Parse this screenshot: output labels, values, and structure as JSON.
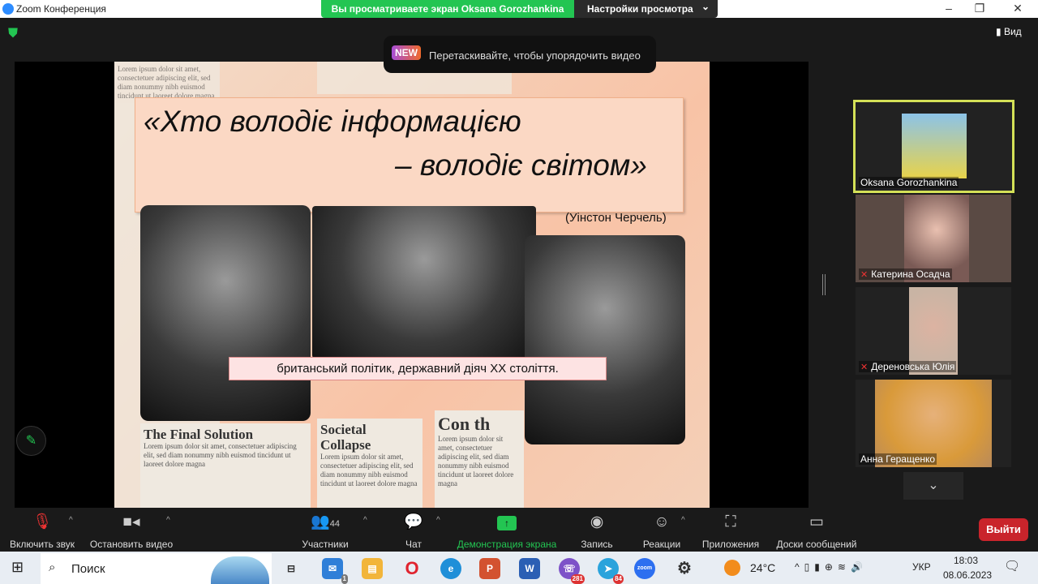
{
  "window": {
    "title": "Zoom Конференция",
    "minimize": "–",
    "restore": "❐",
    "close": "✕"
  },
  "banner": {
    "sharing": "Вы просматриваете экран Oksana Gorozhankina",
    "view_settings": "Настройки просмотра",
    "chevron": "⌄"
  },
  "top": {
    "view": "Вид",
    "new_badge": "NEW",
    "tip": "Перетаскивайте, чтобы упорядочить видео"
  },
  "slide": {
    "quote_line1": "«Хто володіє інформацією",
    "quote_line2": "– володіє світом»",
    "author": "(Уінстон Черчель)",
    "caption": "британський політик, державний діяч XX століття.",
    "headline1": "The Final Solution",
    "headline2": "Societal Collapse",
    "headline3": "Con th",
    "lorem": "Lorem ipsum dolor sit amet, consectetuer adipiscing elit, sed diam nonummy nibh euismod tincidunt ut laoreet dolore magna"
  },
  "participants": [
    {
      "name": "Oksana Gorozhankina",
      "muted": false,
      "color": "#6a9fc9"
    },
    {
      "name": "Катерина Осадча",
      "muted": true,
      "color": "#8a6a5c"
    },
    {
      "name": "Дереновська Юлія",
      "muted": true,
      "color": "#b89a8a"
    },
    {
      "name": "Анна Геращенко",
      "muted": false,
      "color": "#d9a170"
    }
  ],
  "toolbar": {
    "unmute": "Включить звук",
    "stop_video": "Остановить видео",
    "participants": "Участники",
    "participants_count": "44",
    "chat": "Чат",
    "share": "Демонстрация экрана",
    "record": "Запись",
    "reactions": "Реакции",
    "apps": "Приложения",
    "whiteboards": "Доски сообщений",
    "leave": "Выйти"
  },
  "taskbar": {
    "search": "Поиск",
    "mail_badge": "1",
    "viber_badge": "281",
    "telegram_badge": "84",
    "zoom": "zoom",
    "weather": "24°C",
    "lang": "УКР",
    "time": "18:03",
    "date": "08.06.2023"
  },
  "colors": {
    "accent_green": "#23c552",
    "leave_red": "#c9242b",
    "active_speaker": "#d4e157"
  }
}
